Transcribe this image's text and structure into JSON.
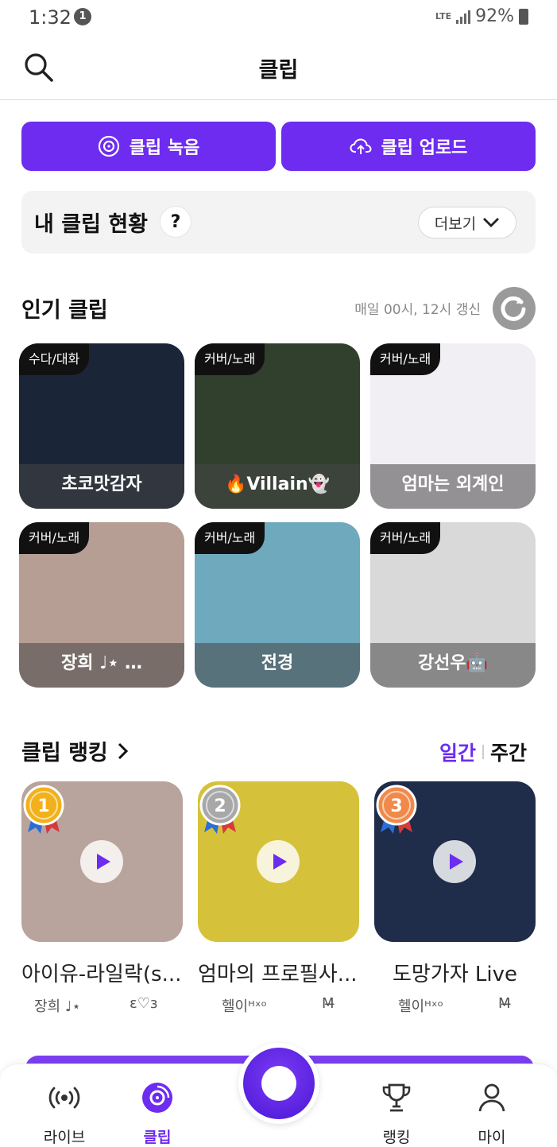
{
  "status_bar": {
    "time": "1:32",
    "notification_count": "1",
    "network": "LTE",
    "battery": "92%"
  },
  "header": {
    "title": "클립"
  },
  "actions": {
    "record_label": "클립 녹음",
    "upload_label": "클립 업로드"
  },
  "my_clip_status": {
    "label": "내 클립 현황",
    "help": "?",
    "more_label": "더보기"
  },
  "popular": {
    "title": "인기 클립",
    "refresh_note": "매일 00시, 12시 갱신",
    "cards": [
      {
        "tag": "수다/대화",
        "caption": "초코맛감자",
        "bg": "#1b2538"
      },
      {
        "tag": "커버/노래",
        "caption": "🔥Villain👻",
        "bg": "#30402d"
      },
      {
        "tag": "커버/노래",
        "caption": "엄마는 외계인",
        "bg": "#f1eef4"
      },
      {
        "tag": "커버/노래",
        "caption": "장희 ♩⋆ …",
        "bg": "#b69e95"
      },
      {
        "tag": "커버/노래",
        "caption": "전경",
        "bg": "#6fa9be"
      },
      {
        "tag": "커버/노래",
        "caption": "강선우🤖",
        "bg": "#d9d9d9"
      }
    ]
  },
  "ranking": {
    "title": "클립 랭킹",
    "tab_daily": "일간",
    "tab_weekly": "주간",
    "items": [
      {
        "rank": "1",
        "title": "아이유-라일락(s...",
        "author": "장희 ♩⋆",
        "author2": "ε♡з",
        "bg": "#b8a49c"
      },
      {
        "rank": "2",
        "title": "엄마의 프로필사...",
        "author": "헬이ᴴˣᵒ",
        "author2": "M̶",
        "bg": "#d6c23a"
      },
      {
        "rank": "3",
        "title": "도망가자 Live",
        "author": "헬이ᴴˣᵒ",
        "author2": "M̶",
        "bg": "#1f2c4a"
      }
    ]
  },
  "nav": {
    "live": "라이브",
    "clip": "클립",
    "ranking": "랭킹",
    "my": "마이"
  },
  "colors": {
    "accent": "#6d2cf0"
  }
}
